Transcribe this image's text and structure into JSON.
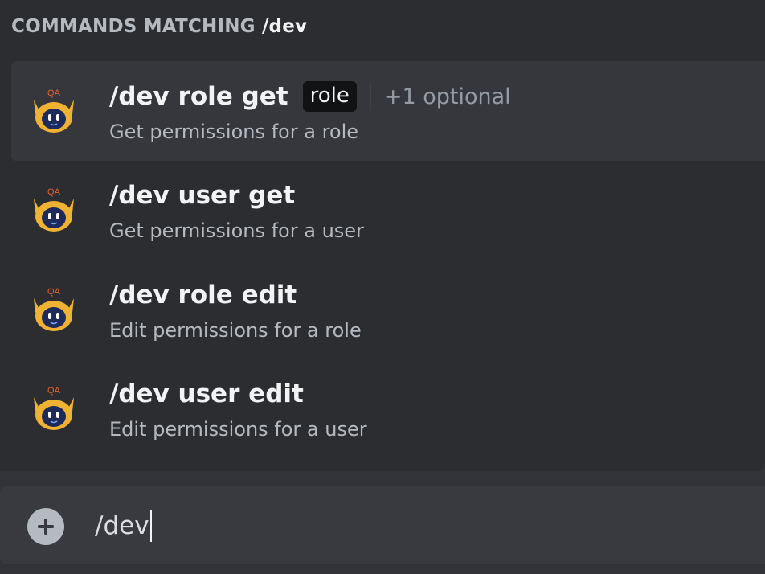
{
  "autocomplete": {
    "header_label": "COMMANDS MATCHING",
    "header_query": "/dev",
    "commands": [
      {
        "name": "/dev role get",
        "description": "Get permissions for a role",
        "param_chip": "role",
        "optional_label": "+1 optional",
        "selected": true,
        "avatar_badge": "QA"
      },
      {
        "name": "/dev user get",
        "description": "Get permissions for a user",
        "selected": false,
        "avatar_badge": "QA"
      },
      {
        "name": "/dev role edit",
        "description": "Edit permissions for a role",
        "selected": false,
        "avatar_badge": "QA"
      },
      {
        "name": "/dev user edit",
        "description": "Edit permissions for a user",
        "selected": false,
        "avatar_badge": "QA"
      }
    ]
  },
  "message_input": {
    "value": "/dev",
    "add_icon": "plus-circle-icon"
  },
  "colors": {
    "background": "#313338",
    "popup": "#2b2d31",
    "selected_row": "#35373c",
    "input_bar": "#383a40",
    "avatar_head": "#f0b232",
    "avatar_face": "#1e2a5a",
    "badge_text": "#e8622c"
  }
}
